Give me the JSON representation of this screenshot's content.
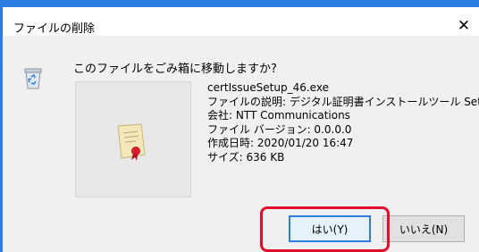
{
  "dialog": {
    "title": "ファイルの削除",
    "close_icon": "close-icon",
    "question": "このファイルをごみ箱に移動しますか?",
    "file": {
      "name": "certIssueSetup_46.exe",
      "description": "ファイルの説明: デジタル証明書インストールツール Setup",
      "company": "会社: NTT Communications",
      "version": "ファイル バージョン: 0.0.0.0",
      "created": "作成日時: 2020/01/20 16:47",
      "size": "サイズ: 636 KB"
    },
    "buttons": {
      "yes_label": "はい(Y)",
      "no_label": "いいえ(N)"
    },
    "icons": {
      "recycle": "recycle-bin-icon",
      "file_preview": "certificate-icon"
    },
    "colors": {
      "accent": "#2b7de1",
      "highlight": "#e0102a"
    }
  }
}
